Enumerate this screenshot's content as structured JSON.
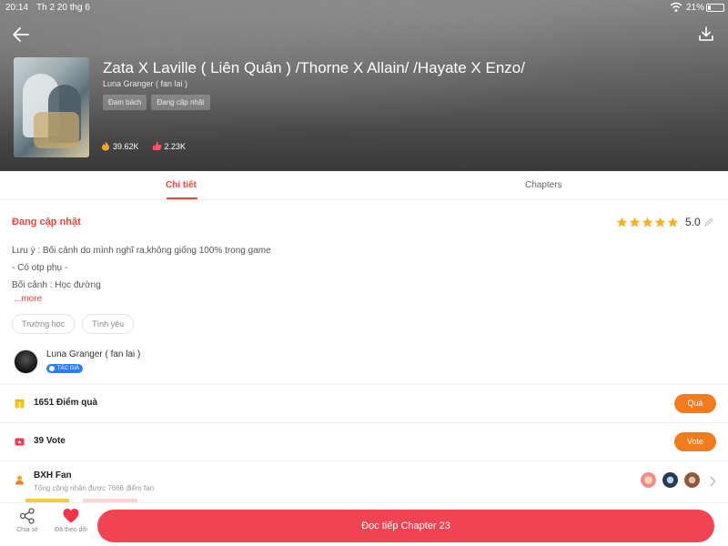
{
  "status_bar": {
    "time": "20:14",
    "date": "Th 2 20 thg 6",
    "battery": "21%",
    "battery_level": 0.21
  },
  "header": {
    "title": "Zata X Laville ( Liên Quân ) /Thorne X Allain/ /Hayate X Enzo/",
    "author": "Luna Granger ( fan lai )",
    "tags": [
      "Đam bách",
      "Đang cập nhật"
    ],
    "views": "39.62K",
    "likes": "2.23K",
    "back_icon": "arrow-left-icon",
    "download_icon": "download-icon"
  },
  "tabs": [
    {
      "label": "Chi tiết",
      "active": true
    },
    {
      "label": "Chapters",
      "active": false
    }
  ],
  "details": {
    "status": "Đang cập nhật",
    "rating": "5.0",
    "rating_stars": 5,
    "description_lines": [
      "Lưu ý : Bối cảnh do mình nghĩ ra,không giống 100% trong game",
      "- Có otp phụ -",
      "Bối cảnh : Học đường"
    ],
    "more": "...more",
    "genre_tags": [
      "Trường học",
      "Tình yêu"
    ]
  },
  "author_card": {
    "name": "Luna Granger ( fan lai )",
    "badge": "TÁC GIẢ"
  },
  "gift_row": {
    "label": "1651 Điểm quà",
    "button": "Quà"
  },
  "vote_row": {
    "label": "39 Vote",
    "button": "Vote"
  },
  "fan_row": {
    "label": "BXH Fan",
    "subtitle": "Tổng cộng nhận được 7666 điểm fan"
  },
  "bottom": {
    "share": "Chia sẻ",
    "follow": "Đã theo dõi",
    "read": "Đọc tiếp Chapter 23"
  },
  "colors": {
    "accent": "#e8473e",
    "orange": "#f07c1f",
    "cta": "#f04452",
    "badge": "#2f7cf6"
  }
}
